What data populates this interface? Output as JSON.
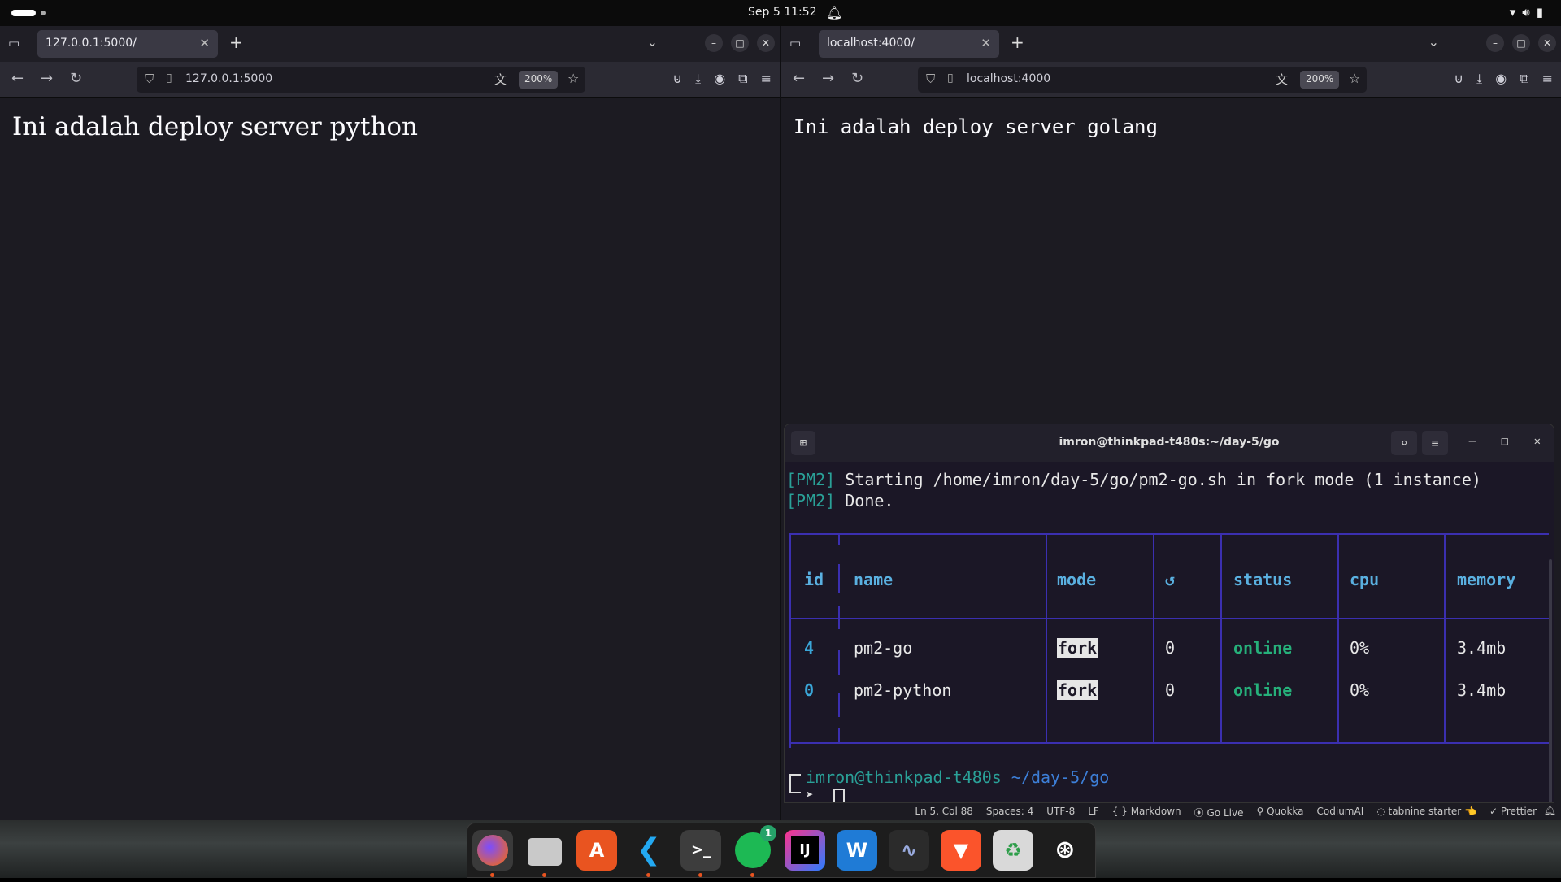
{
  "topbar": {
    "clock": "Sep 5  11:52",
    "tray_icons": [
      "wifi-icon",
      "volume-icon",
      "battery-icon"
    ]
  },
  "left_browser": {
    "tab_title": "127.0.0.1:5000/",
    "url": "127.0.0.1:5000",
    "zoom": "200%",
    "page_text": "Ini adalah deploy server python"
  },
  "right_browser": {
    "tab_title": "localhost:4000/",
    "url": "localhost:4000",
    "zoom": "200%",
    "page_text": "Ini adalah deploy server golang"
  },
  "terminal": {
    "title": "imron@thinkpad-t480s:~/day-5/go",
    "line1_tag": "[PM2]",
    "line1_text": " Starting /home/imron/day-5/go/pm2-go.sh in fork_mode (1 instance)",
    "line2_tag": "[PM2]",
    "line2_text": " Done.",
    "table": {
      "headers": [
        "id",
        "name",
        "mode",
        "↺",
        "status",
        "cpu",
        "memory"
      ],
      "rows": [
        {
          "id": "4",
          "name": "pm2-go",
          "mode": "fork",
          "restarts": "0",
          "status": "online",
          "cpu": "0%",
          "memory": "3.4mb"
        },
        {
          "id": "0",
          "name": "pm2-python",
          "mode": "fork",
          "restarts": "0",
          "status": "online",
          "cpu": "0%",
          "memory": "3.4mb"
        }
      ]
    },
    "prompt_user": "imron@thinkpad-t480s",
    "prompt_path": " ~/day-5/go"
  },
  "statusbar": {
    "position": "Ln 5, Col 88",
    "spaces": "Spaces: 4",
    "encoding": "UTF-8",
    "eol": "LF",
    "language": "{ }  Markdown",
    "golive": "Go Live",
    "quokka": "Quokka",
    "codium": "CodiumAI",
    "tabnine": "tabnine starter",
    "prettier": "Prettier"
  },
  "dock": {
    "spotify_badge": "1",
    "intellij_label": "IJ",
    "apps": [
      "firefox",
      "files",
      "app-center",
      "vscode",
      "terminal",
      "spotify",
      "intellij",
      "wps",
      "system-monitor",
      "brave",
      "trash",
      "ubuntu"
    ]
  }
}
